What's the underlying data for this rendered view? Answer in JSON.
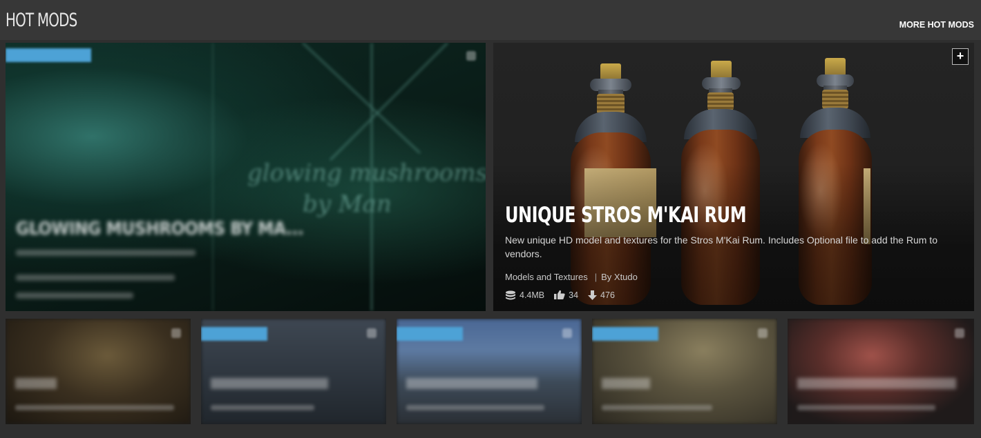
{
  "header": {
    "title": "HOT MODS",
    "more_link": "MORE HOT MODS"
  },
  "featured": {
    "title": "UNIQUE STROS M'KAI RUM",
    "description": "New unique HD model and textures for the Stros M'Kai Rum. Includes Optional file to add the Rum to vendors.",
    "category": "Models and Textures",
    "author": "By Xtudo",
    "size": "4.4MB",
    "endorsements": "34",
    "downloads": "476",
    "add_button": "+"
  },
  "left_tile": {
    "title": "GLOWING MUSHROOMS BY MA..."
  },
  "colors": {
    "background": "#2f2f2f",
    "header_bar": "#373737",
    "badge": "#4da2d6"
  },
  "icons": {
    "size": "database-icon",
    "endorse": "thumbs-up-icon",
    "download": "download-icon"
  }
}
